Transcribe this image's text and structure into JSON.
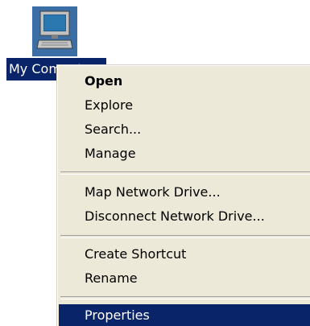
{
  "desktop": {
    "icon_label": "My Computer",
    "icon": "computer-icon"
  },
  "context_menu": {
    "items": [
      {
        "label": "Open",
        "bold": true
      },
      {
        "label": "Explore"
      },
      {
        "label": "Search..."
      },
      {
        "label": "Manage"
      },
      {
        "label": "Map Network Drive..."
      },
      {
        "label": "Disconnect Network Drive..."
      },
      {
        "label": "Create Shortcut"
      },
      {
        "label": "Rename"
      },
      {
        "label": "Properties",
        "highlighted": true
      }
    ]
  },
  "colors": {
    "selection": "#0a246a",
    "icon_selected_bg": "#3a6ea5",
    "menu_bg": "#ece9d8"
  }
}
